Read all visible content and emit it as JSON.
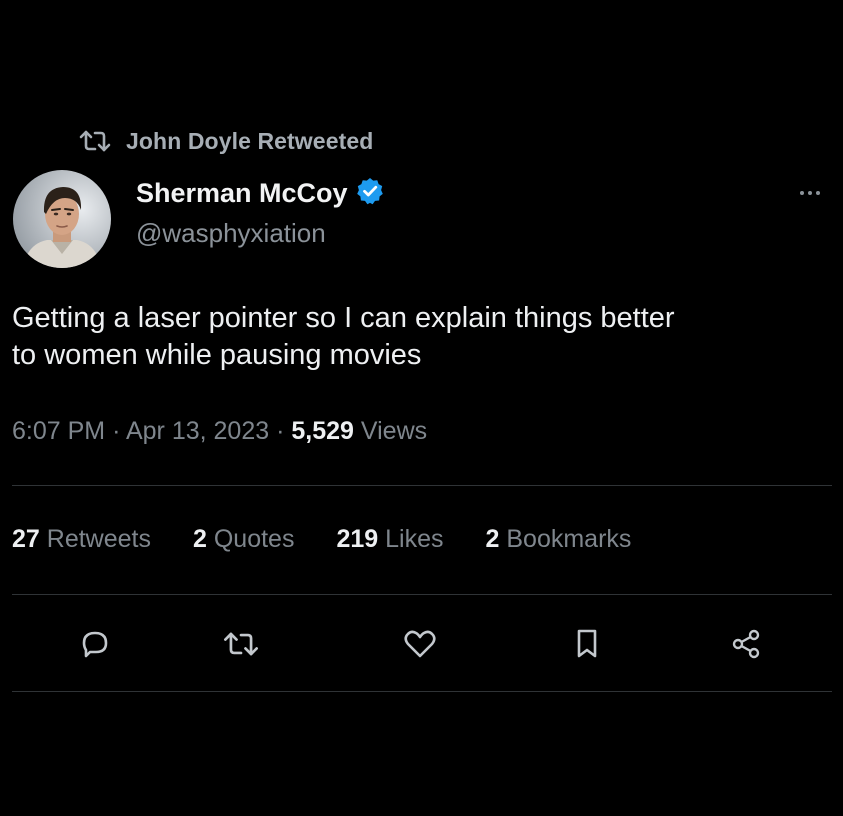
{
  "retweet_context": {
    "icon": "retweet-icon",
    "label": "John Doyle Retweeted"
  },
  "author": {
    "name": "Sherman McCoy",
    "handle": "@wasphyxiation",
    "verified_icon": "verified-badge-icon",
    "verified_color": "#1d9bf0"
  },
  "tweet": {
    "text_line1": "Getting a laser pointer so I can explain things better",
    "text_line2": "to women while pausing movies"
  },
  "meta": {
    "time": "6:07 PM",
    "separator": "·",
    "date": "Apr 13, 2023",
    "views_count": "5,529",
    "views_label": "Views"
  },
  "stats": {
    "retweets_count": "27",
    "retweets_label": "Retweets",
    "quotes_count": "2",
    "quotes_label": "Quotes",
    "likes_count": "219",
    "likes_label": "Likes",
    "bookmarks_count": "2",
    "bookmarks_label": "Bookmarks"
  },
  "actions": [
    "reply-icon",
    "retweet-icon",
    "like-icon",
    "bookmark-icon",
    "share-icon"
  ],
  "colors": {
    "background": "#000000",
    "primary_text": "#e7e9ea",
    "secondary_text": "#7f868d",
    "divider": "#2f3336",
    "accent": "#1d9bf0"
  }
}
